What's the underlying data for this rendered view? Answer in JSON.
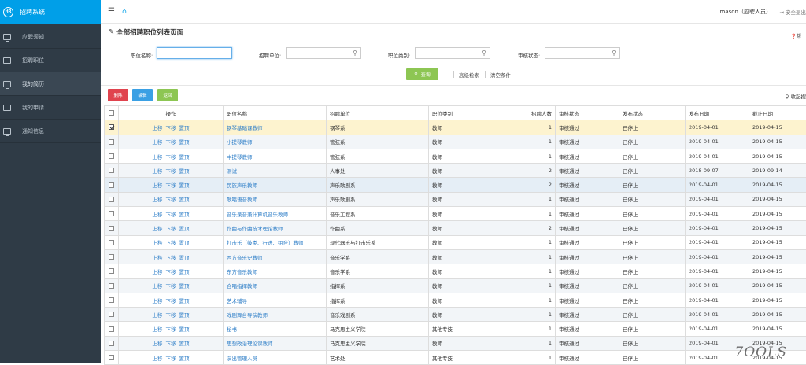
{
  "app": {
    "logo": "HR",
    "title": "招聘系统"
  },
  "sidebar": {
    "items": [
      {
        "label": "应聘须知",
        "icon": "monitor-icon",
        "active": false
      },
      {
        "label": "招聘职位",
        "icon": "monitor-icon",
        "active": false
      },
      {
        "label": "我的简历",
        "icon": "monitor-icon",
        "active": true
      },
      {
        "label": "我的申请",
        "icon": "monitor-icon",
        "active": false
      },
      {
        "label": "通知信息",
        "icon": "monitor-icon",
        "active": false
      }
    ]
  },
  "topbar": {
    "user": "mason（应聘人员）",
    "logout": "安全退出"
  },
  "page": {
    "title": "全部招聘职位列表页面",
    "help": "帮"
  },
  "filters": {
    "name_label": "职位名称:",
    "name_value": "",
    "unit_label": "招聘单位:",
    "unit_value": "",
    "category_label": "职位类别:",
    "category_value": "",
    "status_label": "审核状态:",
    "status_value": ""
  },
  "actions": {
    "query": "查询",
    "advanced": "高级检索",
    "clear": "清空条件"
  },
  "toolbar": {
    "delete": "删除",
    "edit": "编辑",
    "back": "返回",
    "collapse": "收起搜"
  },
  "colors": {
    "delete": "#e0434e",
    "edit": "#3aa0e4",
    "back": "#8dc653",
    "accent": "#009fe8"
  },
  "table": {
    "headers": [
      "操作",
      "职位名称",
      "招聘单位",
      "职位类别",
      "招聘人数",
      "审核状态",
      "发布状态",
      "发布日期",
      "截止日期"
    ],
    "op_labels": [
      "上移",
      "下移",
      "置顶"
    ],
    "rows": [
      {
        "checked": true,
        "name": "钢琴基础课教师",
        "unit": "钢琴系",
        "category": "教师",
        "count": "1",
        "audit": "审核通过",
        "publish": "已停止",
        "start": "2019-04-01",
        "end": "2019-04-15"
      },
      {
        "checked": false,
        "name": "小提琴教师",
        "unit": "管弦系",
        "category": "教师",
        "count": "1",
        "audit": "审核通过",
        "publish": "已停止",
        "start": "2019-04-01",
        "end": "2019-04-15"
      },
      {
        "checked": false,
        "name": "中提琴教师",
        "unit": "管弦系",
        "category": "教师",
        "count": "1",
        "audit": "审核通过",
        "publish": "已停止",
        "start": "2019-04-01",
        "end": "2019-04-15"
      },
      {
        "checked": false,
        "name": "测试",
        "unit": "人事处",
        "category": "教师",
        "count": "2",
        "audit": "审核通过",
        "publish": "已停止",
        "start": "2018-09-07",
        "end": "2019-09-14"
      },
      {
        "checked": false,
        "name": "民族声乐教师",
        "unit": "声乐歌剧系",
        "category": "教师",
        "count": "2",
        "audit": "审核通过",
        "publish": "已停止",
        "start": "2019-04-01",
        "end": "2019-04-15"
      },
      {
        "checked": false,
        "name": "歌唱语音教师",
        "unit": "声乐歌剧系",
        "category": "教师",
        "count": "1",
        "audit": "审核通过",
        "publish": "已停止",
        "start": "2019-04-01",
        "end": "2019-04-15"
      },
      {
        "checked": false,
        "name": "音乐录音兼计算机音乐教师",
        "unit": "音乐工程系",
        "category": "教师",
        "count": "1",
        "audit": "审核通过",
        "publish": "已停止",
        "start": "2019-04-01",
        "end": "2019-04-15"
      },
      {
        "checked": false,
        "name": "作曲与作曲技术理论教师",
        "unit": "作曲系",
        "category": "教师",
        "count": "2",
        "audit": "审核通过",
        "publish": "已停止",
        "start": "2019-04-01",
        "end": "2019-04-15"
      },
      {
        "checked": false,
        "name": "打击乐（鼓类、行进、组合）教师",
        "unit": "现代器乐与打击乐系",
        "category": "教师",
        "count": "1",
        "audit": "审核通过",
        "publish": "已停止",
        "start": "2019-04-01",
        "end": "2019-04-15"
      },
      {
        "checked": false,
        "name": "西方音乐史教师",
        "unit": "音乐学系",
        "category": "教师",
        "count": "1",
        "audit": "审核通过",
        "publish": "已停止",
        "start": "2019-04-01",
        "end": "2019-04-15"
      },
      {
        "checked": false,
        "name": "东方音乐教师",
        "unit": "音乐学系",
        "category": "教师",
        "count": "1",
        "audit": "审核通过",
        "publish": "已停止",
        "start": "2019-04-01",
        "end": "2019-04-15"
      },
      {
        "checked": false,
        "name": "合唱指挥教师",
        "unit": "指挥系",
        "category": "教师",
        "count": "1",
        "audit": "审核通过",
        "publish": "已停止",
        "start": "2019-04-01",
        "end": "2019-04-15"
      },
      {
        "checked": false,
        "name": "艺术辅导",
        "unit": "指挥系",
        "category": "教师",
        "count": "1",
        "audit": "审核通过",
        "publish": "已停止",
        "start": "2019-04-01",
        "end": "2019-04-15"
      },
      {
        "checked": false,
        "name": "戏剧舞台导演教师",
        "unit": "音乐戏剧系",
        "category": "教师",
        "count": "1",
        "audit": "审核通过",
        "publish": "已停止",
        "start": "2019-04-01",
        "end": "2019-04-15"
      },
      {
        "checked": false,
        "name": "秘书",
        "unit": "马克思主义学院",
        "category": "其他专技",
        "count": "1",
        "audit": "审核通过",
        "publish": "已停止",
        "start": "2019-04-01",
        "end": "2019-04-15"
      },
      {
        "checked": false,
        "name": "思想政治理论课教师",
        "unit": "马克思主义学院",
        "category": "教师",
        "count": "1",
        "audit": "审核通过",
        "publish": "已停止",
        "start": "2019-04-01",
        "end": "2019-04-15"
      },
      {
        "checked": false,
        "name": "演出管理人员",
        "unit": "艺术处",
        "category": "其他专技",
        "count": "1",
        "audit": "审核通过",
        "publish": "已停止",
        "start": "2019-04-01",
        "end": "2019-04-15"
      }
    ]
  },
  "watermark": "7OOLS"
}
